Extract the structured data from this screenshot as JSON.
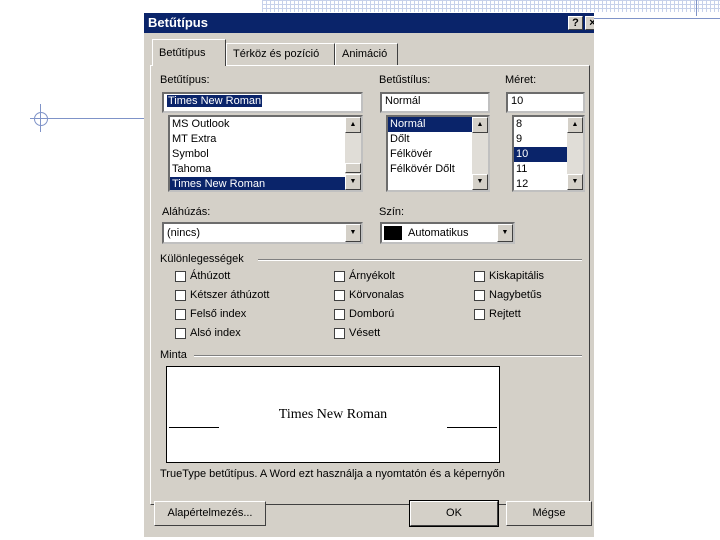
{
  "dialog": {
    "title": "Betűtípus",
    "help_btn": "?",
    "close_btn": "×"
  },
  "tabs": [
    {
      "label": "Betűtípus",
      "active": true
    },
    {
      "label": "Térköz és pozíció",
      "active": false
    },
    {
      "label": "Animáció",
      "active": false
    }
  ],
  "font": {
    "label": "Betűtípus:",
    "value": "Times New Roman",
    "options": [
      "MS Outlook",
      "MT Extra",
      "Symbol",
      "Tahoma",
      "Times New Roman"
    ],
    "selected": "Times New Roman"
  },
  "style": {
    "label": "Betűstílus:",
    "value": "Normál",
    "options": [
      "Normál",
      "Dőlt",
      "Félkövér",
      "Félkövér Dőlt"
    ],
    "selected": "Normál"
  },
  "size": {
    "label": "Méret:",
    "value": "10",
    "options": [
      "8",
      "9",
      "10",
      "11",
      "12"
    ],
    "selected": "10"
  },
  "underline": {
    "label": "Aláhúzás:",
    "value": "(nincs)"
  },
  "color": {
    "label": "Szín:",
    "value": "Automatikus",
    "swatch": "#000000"
  },
  "effects": {
    "label": "Különlegességek",
    "col1": [
      "Áthúzott",
      "Kétszer áthúzott",
      "Felső index",
      "Alsó index"
    ],
    "col2": [
      "Árnyékolt",
      "Körvonalas",
      "Domború",
      "Vésett"
    ],
    "col3": [
      "Kiskapitális",
      "Nagybetűs",
      "Rejtett"
    ]
  },
  "preview": {
    "label": "Minta",
    "text": "Times New Roman",
    "note": "TrueType betűtípus. A Word ezt használja a nyomtatón és a képernyőn"
  },
  "buttons": {
    "default": "Alapértelmezés...",
    "ok": "OK",
    "cancel": "Mégse"
  },
  "colors": {
    "titlebar": "#0a246a",
    "face": "#d4d0c8",
    "selection": "#0a246a"
  }
}
